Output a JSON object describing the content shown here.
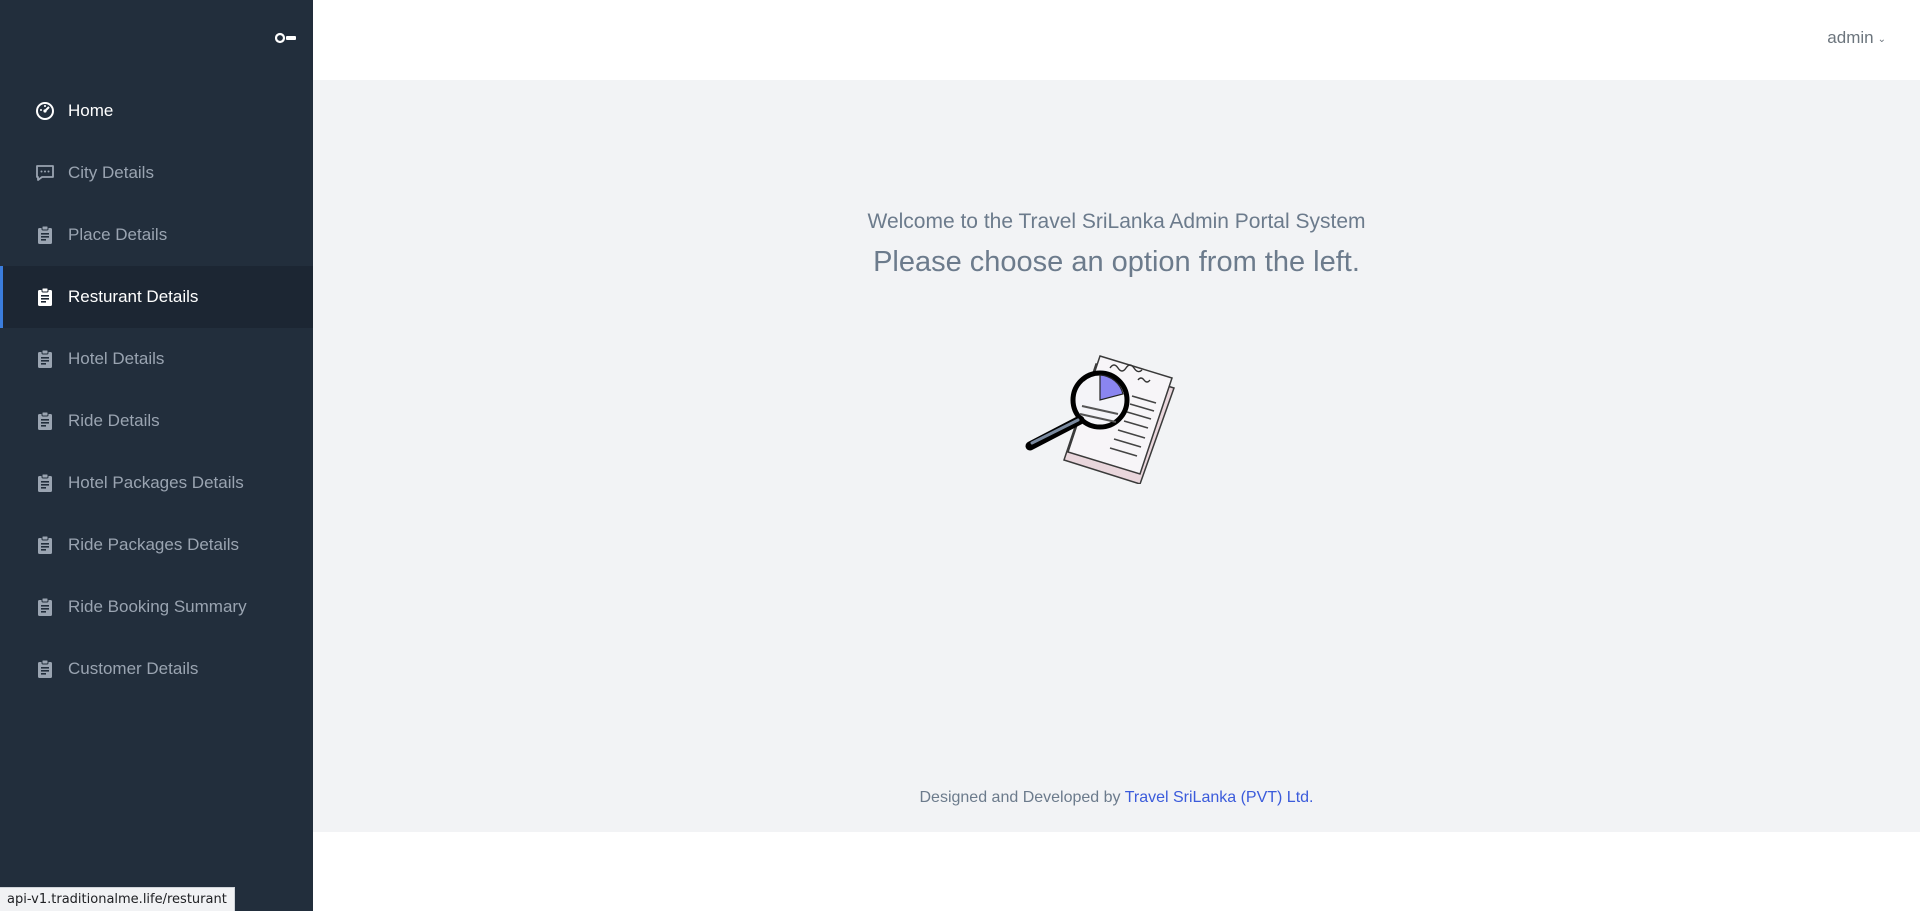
{
  "sidebar": {
    "items": [
      {
        "label": "Home",
        "icon": "dashboard-icon",
        "active": false
      },
      {
        "label": "City Details",
        "icon": "message-square-icon",
        "active": false
      },
      {
        "label": "Place Details",
        "icon": "clipboard-icon",
        "active": false
      },
      {
        "label": "Resturant Details",
        "icon": "clipboard-icon",
        "active": true
      },
      {
        "label": "Hotel Details",
        "icon": "clipboard-icon",
        "active": false
      },
      {
        "label": "Ride Details",
        "icon": "clipboard-icon",
        "active": false
      },
      {
        "label": "Hotel Packages Details",
        "icon": "clipboard-icon",
        "active": false
      },
      {
        "label": "Ride Packages Details",
        "icon": "clipboard-icon",
        "active": false
      },
      {
        "label": "Ride Booking Summary",
        "icon": "clipboard-icon",
        "active": false
      },
      {
        "label": "Customer Details",
        "icon": "clipboard-icon",
        "active": false
      }
    ]
  },
  "header": {
    "user_label": "admin"
  },
  "main": {
    "welcome_line1": "Welcome to the Travel SriLanka Admin Portal System",
    "welcome_line2": "Please choose an option from the left."
  },
  "footer": {
    "prefix": "Designed and Developed by",
    "link_text": "Travel SriLanka (PVT) Ltd."
  },
  "status_bar": {
    "url": "api-v1.traditionalme.life/resturant"
  },
  "colors": {
    "sidebar_bg": "#222e3c",
    "accent": "#3b7ddd",
    "main_bg": "#f2f3f5"
  }
}
